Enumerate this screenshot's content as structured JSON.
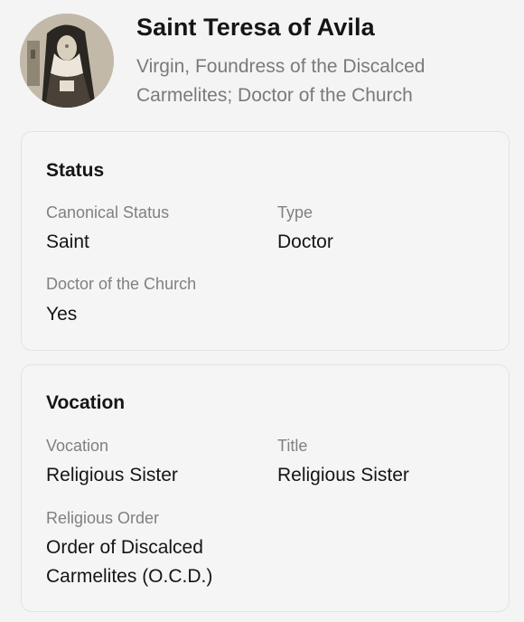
{
  "header": {
    "name": "Saint Teresa of Avila",
    "description": "Virgin, Foundress of the Discalced Carmelites; Doctor of the Church"
  },
  "status_section": {
    "title": "Status",
    "canonical_status": {
      "label": "Canonical Status",
      "value": "Saint"
    },
    "type": {
      "label": "Type",
      "value": "Doctor"
    },
    "doctor_of_church": {
      "label": "Doctor of the Church",
      "value": "Yes"
    }
  },
  "vocation_section": {
    "title": "Vocation",
    "vocation": {
      "label": "Vocation",
      "value": "Religious Sister"
    },
    "title_field": {
      "label": "Title",
      "value": "Religious Sister"
    },
    "religious_order": {
      "label": "Religious Order",
      "value": "Order of Discalced Carmelites (O.C.D.)"
    }
  }
}
